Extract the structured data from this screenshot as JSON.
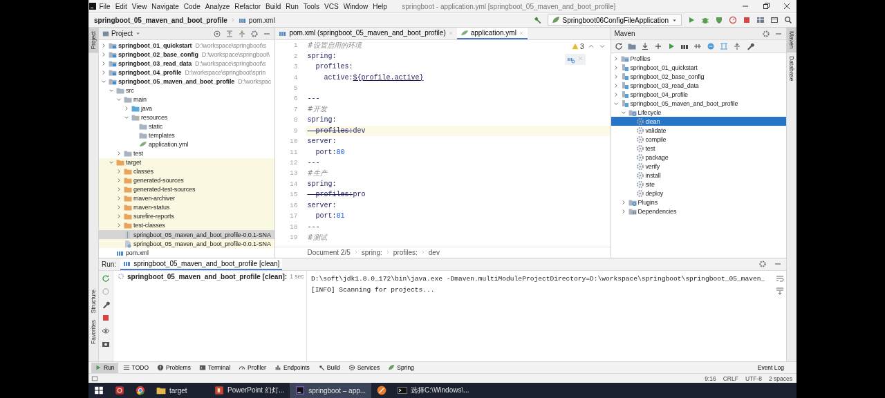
{
  "window": {
    "menu": [
      "File",
      "Edit",
      "View",
      "Navigate",
      "Code",
      "Analyze",
      "Refactor",
      "Build",
      "Run",
      "Tools",
      "VCS",
      "Window",
      "Help"
    ],
    "title": "springboot - application.yml [springboot_05_maven_and_boot_profile]"
  },
  "navbar": {
    "crumbs": [
      {
        "label": "springboot_05_maven_and_boot_profile",
        "kind": "project"
      },
      {
        "label": "pom.xml",
        "kind": "pom"
      }
    ],
    "run_config": "Springboot06ConfigFileApplication"
  },
  "left_stripe": {
    "top": [
      {
        "label": "Project",
        "selected": true
      }
    ],
    "bottom": [
      {
        "label": "Structure",
        "selected": false
      },
      {
        "label": "Favorites",
        "selected": false
      }
    ]
  },
  "right_stripe": [
    {
      "label": "Maven",
      "selected": true
    },
    {
      "label": "Database",
      "selected": false
    }
  ],
  "project": {
    "title": "Project",
    "tree": [
      {
        "label": "springboot_01_quickstart",
        "path": "D:\\workspace\\springboot\\s",
        "kind": "module",
        "expanded": false,
        "selected": false
      },
      {
        "label": "springboot_02_base_config",
        "path": "D:\\workspace\\springboot\\",
        "kind": "module",
        "expanded": false,
        "selected": false
      },
      {
        "label": "springboot_03_read_data",
        "path": "D:\\workspace\\springboot\\s",
        "kind": "module",
        "expanded": false,
        "selected": false
      },
      {
        "label": "springboot_04_profile",
        "path": "D:\\workspace\\springboot\\sprin",
        "kind": "module",
        "expanded": false,
        "selected": false
      },
      {
        "label": "springboot_05_maven_and_boot_profile",
        "path": "D:\\workspac",
        "kind": "module",
        "expanded": true,
        "selected": false,
        "children": [
          {
            "label": "src",
            "kind": "folder",
            "expanded": true,
            "selected": false,
            "children": [
              {
                "label": "main",
                "kind": "folder",
                "expanded": true,
                "selected": false,
                "children": [
                  {
                    "label": "java",
                    "kind": "source",
                    "expanded": false,
                    "selected": false
                  },
                  {
                    "label": "resources",
                    "kind": "resources",
                    "expanded": true,
                    "selected": false,
                    "children": [
                      {
                        "label": "static",
                        "kind": "folder",
                        "selected": false
                      },
                      {
                        "label": "templates",
                        "kind": "folder",
                        "selected": false
                      },
                      {
                        "label": "application.yml",
                        "kind": "yml",
                        "selected": false
                      }
                    ]
                  }
                ]
              },
              {
                "label": "test",
                "kind": "folder",
                "expanded": false,
                "selected": false
              }
            ]
          },
          {
            "label": "target",
            "kind": "target",
            "expanded": true,
            "selected": false,
            "children": [
              {
                "label": "classes",
                "kind": "excluded",
                "expanded": false,
                "selected": false
              },
              {
                "label": "generated-sources",
                "kind": "excluded",
                "expanded": false,
                "selected": false
              },
              {
                "label": "generated-test-sources",
                "kind": "excluded",
                "expanded": false,
                "selected": false
              },
              {
                "label": "maven-archiver",
                "kind": "excluded",
                "expanded": false,
                "selected": false
              },
              {
                "label": "maven-status",
                "kind": "excluded",
                "expanded": false,
                "selected": false
              },
              {
                "label": "surefire-reports",
                "kind": "excluded",
                "expanded": false,
                "selected": false
              },
              {
                "label": "test-classes",
                "kind": "excluded",
                "expanded": false,
                "selected": false
              },
              {
                "label": "springboot_05_maven_and_boot_profile-0.0.1-SNA",
                "kind": "jar",
                "selected": true
              },
              {
                "label": "springboot_05_maven_and_boot_profile-0.0.1-SNA",
                "kind": "jar-original",
                "selected": false
              }
            ]
          },
          {
            "label": "pom.xml",
            "kind": "pom",
            "selected": false
          }
        ]
      }
    ]
  },
  "editor": {
    "tabs": [
      {
        "label": "pom.xml (springboot_05_maven_and_boot_profile)",
        "kind": "pom",
        "selected": false
      },
      {
        "label": "application.yml",
        "kind": "yml",
        "selected": true
      }
    ],
    "warnings": "3",
    "lines": [
      {
        "number": "1",
        "kind": "comment",
        "text": "#设置启用的环境",
        "current": false
      },
      {
        "number": "2",
        "kind": "entry",
        "key": "spring:",
        "current": false
      },
      {
        "number": "3",
        "kind": "entry",
        "key": "  profiles:",
        "current": false
      },
      {
        "number": "4",
        "kind": "entry",
        "key": "    active:",
        "value": {
          "text": "${profile.active}",
          "kind": "reference"
        },
        "current": false
      },
      {
        "number": "5",
        "kind": "blank",
        "current": false
      },
      {
        "number": "6",
        "kind": "separator",
        "text": "---",
        "current": false
      },
      {
        "number": "7",
        "kind": "comment",
        "text": "#开发",
        "current": false
      },
      {
        "number": "8",
        "kind": "entry",
        "key": "spring:",
        "current": false
      },
      {
        "number": "9",
        "kind": "entry",
        "key": "  profiles:",
        "deprecated": true,
        "value": {
          "text": "dev",
          "kind": "text"
        },
        "current": true
      },
      {
        "number": "10",
        "kind": "entry",
        "key": "server:",
        "current": false
      },
      {
        "number": "11",
        "kind": "entry",
        "key": "  port:",
        "value": {
          "text": "80",
          "kind": "number"
        },
        "current": false
      },
      {
        "number": "12",
        "kind": "separator",
        "text": "---",
        "current": false
      },
      {
        "number": "13",
        "kind": "comment",
        "text": "#生产",
        "current": false
      },
      {
        "number": "14",
        "kind": "entry",
        "key": "spring:",
        "current": false
      },
      {
        "number": "15",
        "kind": "entry",
        "key": "  profiles:",
        "deprecated": true,
        "value": {
          "text": "pro",
          "kind": "text"
        },
        "current": false
      },
      {
        "number": "16",
        "kind": "entry",
        "key": "server:",
        "current": false
      },
      {
        "number": "17",
        "kind": "entry",
        "key": "  port:",
        "value": {
          "text": "81",
          "kind": "number"
        },
        "current": false
      },
      {
        "number": "18",
        "kind": "separator",
        "text": "---",
        "current": false
      },
      {
        "number": "19",
        "kind": "comment",
        "text": "#测试",
        "current": false
      }
    ],
    "breadcrumbs": [
      "Document 2/5",
      "spring:",
      "profiles:",
      "dev"
    ]
  },
  "maven": {
    "title": "Maven",
    "tree": [
      {
        "label": "Profiles",
        "kind": "profiles",
        "expanded": false,
        "selected": false
      },
      {
        "label": "springboot_01_quickstart",
        "kind": "project",
        "expanded": false,
        "selected": false
      },
      {
        "label": "springboot_02_base_config",
        "kind": "project",
        "expanded": false,
        "selected": false
      },
      {
        "label": "springboot_03_read_data",
        "kind": "project",
        "expanded": false,
        "selected": false
      },
      {
        "label": "springboot_04_profile",
        "kind": "project",
        "expanded": false,
        "selected": false
      },
      {
        "label": "springboot_05_maven_and_boot_profile",
        "kind": "project",
        "expanded": true,
        "selected": false,
        "children": [
          {
            "label": "Lifecycle",
            "kind": "lifecycle",
            "expanded": true,
            "selected": false,
            "children": [
              {
                "label": "clean",
                "kind": "goal",
                "selected": true
              },
              {
                "label": "validate",
                "kind": "goal",
                "selected": false
              },
              {
                "label": "compile",
                "kind": "goal",
                "selected": false
              },
              {
                "label": "test",
                "kind": "goal",
                "selected": false
              },
              {
                "label": "package",
                "kind": "goal",
                "selected": false
              },
              {
                "label": "verify",
                "kind": "goal",
                "selected": false
              },
              {
                "label": "install",
                "kind": "goal",
                "selected": false
              },
              {
                "label": "site",
                "kind": "goal",
                "selected": false
              },
              {
                "label": "deploy",
                "kind": "goal",
                "selected": false
              }
            ]
          },
          {
            "label": "Plugins",
            "kind": "lifecycle",
            "expanded": false,
            "selected": false
          },
          {
            "label": "Dependencies",
            "kind": "dependencies",
            "expanded": false,
            "selected": false
          }
        ]
      }
    ]
  },
  "run": {
    "label": "Run:",
    "tab": "springboot_05_maven_and_boot_profile [clean]",
    "task": {
      "label": "springboot_05_maven_and_boot_profile [clean]:",
      "time": "1 sec"
    },
    "console": [
      "D:\\soft\\jdk1.8.0_172\\bin\\java.exe -Dmaven.multiModuleProjectDirectory=D:\\workspace\\springboot\\springboot_05_maven_",
      "[INFO] Scanning for projects..."
    ]
  },
  "tool_tabs": [
    {
      "label": "Run",
      "kind": "run",
      "selected": true
    },
    {
      "label": "TODO",
      "kind": "todo",
      "selected": false
    },
    {
      "label": "Problems",
      "kind": "problems",
      "selected": false
    },
    {
      "label": "Terminal",
      "kind": "terminal",
      "selected": false
    },
    {
      "label": "Profiler",
      "kind": "profiler",
      "selected": false
    },
    {
      "label": "Endpoints",
      "kind": "endpoints",
      "selected": false
    },
    {
      "label": "Build",
      "kind": "build",
      "selected": false
    },
    {
      "label": "Services",
      "kind": "services",
      "selected": false
    },
    {
      "label": "Spring",
      "kind": "spring",
      "selected": false
    }
  ],
  "event_log": "Event Log",
  "status": [
    "9:16",
    "CRLF",
    "UTF-8",
    "2 spaces"
  ],
  "taskbar": [
    {
      "kind": "start",
      "selected": false
    },
    {
      "kind": "app",
      "selected": false
    },
    {
      "kind": "browser",
      "selected": false
    },
    {
      "kind": "folder",
      "label": "target",
      "selected": false
    },
    {
      "kind": "slides",
      "label": "PowerPoint 幻灯...",
      "selected": false
    },
    {
      "kind": "ide",
      "label": "springboot – app...",
      "selected": true
    },
    {
      "kind": "orange",
      "selected": false
    },
    {
      "kind": "console",
      "label": "选择C:\\Windows\\...",
      "selected": false
    }
  ]
}
